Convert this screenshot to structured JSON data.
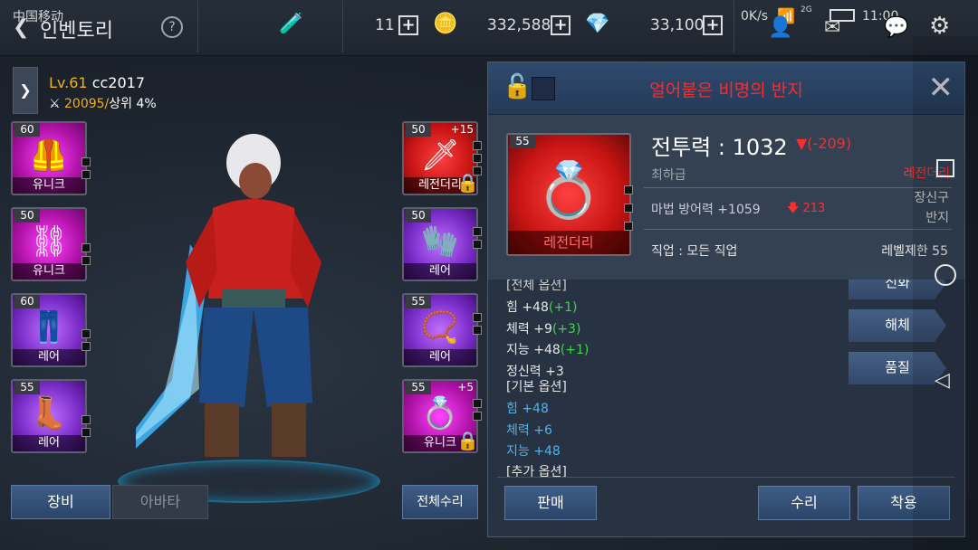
{
  "status_bar": {
    "carrier": "中国移动",
    "network_speed": "0K/s",
    "signal": "2G",
    "time": "11:00"
  },
  "header": {
    "title": "인벤토리",
    "help": "?"
  },
  "resources": [
    {
      "icon": "energy-icon",
      "value": ""
    },
    {
      "icon": "ticket-icon",
      "value": "11"
    },
    {
      "icon": "gold-coin-icon",
      "value": "332,588"
    },
    {
      "icon": "gem-icon",
      "value": "33,100"
    }
  ],
  "character": {
    "level": "Lv.61",
    "name": "cc2017",
    "power": "20095/",
    "rank": "상위 4%"
  },
  "left_slots": [
    {
      "level": "60",
      "rarity": "유니크",
      "rclass": "unique",
      "icon": "armor-top-icon",
      "glyph": "🦺"
    },
    {
      "level": "50",
      "rarity": "유니크",
      "rclass": "unique",
      "icon": "belt-icon",
      "glyph": "⛓"
    },
    {
      "level": "60",
      "rarity": "레어",
      "rclass": "rare",
      "icon": "pants-icon",
      "glyph": "👖"
    },
    {
      "level": "55",
      "rarity": "레어",
      "rclass": "rare",
      "icon": "boots-icon",
      "glyph": "👢"
    }
  ],
  "right_slots": [
    {
      "level": "50",
      "enhance": "+15",
      "rarity": "레전더리",
      "rclass": "legend",
      "icon": "sword-icon",
      "glyph": "🗡",
      "locked": true
    },
    {
      "level": "50",
      "enhance": "",
      "rarity": "레어",
      "rclass": "rare",
      "icon": "gauntlet-icon",
      "glyph": "🧤",
      "locked": false
    },
    {
      "level": "55",
      "enhance": "",
      "rarity": "레어",
      "rclass": "rare",
      "icon": "necklace-icon",
      "glyph": "📿",
      "locked": false
    },
    {
      "level": "55",
      "enhance": "+5",
      "rarity": "유니크",
      "rclass": "unique",
      "icon": "ring-icon",
      "glyph": "💍",
      "locked": true
    }
  ],
  "bottom_tabs": {
    "equip": "장비",
    "avatar": "아바타",
    "repair_all": "전체수리"
  },
  "item_detail": {
    "name": "얼어붙은 비명의 반지",
    "level": "55",
    "rarity": "레전더리",
    "combat_power_label": "전투력 : 1032",
    "combat_power_delta": "▼(-209)",
    "grade": "최하급",
    "grade_right": "레전더리",
    "slot_label": "장신구\n반지",
    "magic_def": "마법 방어력 +1059",
    "magic_def_delta": "213",
    "job": "직업 : 모든 직업",
    "req_level": "레벨제한 55",
    "stats_header_partial": "[전체 옵션]",
    "stats": [
      {
        "base": "힘 +48",
        "bonus": "(+1)"
      },
      {
        "base": "체력 +9",
        "bonus": "(+3)"
      },
      {
        "base": "지능 +48",
        "bonus": "(+1)"
      },
      {
        "base": "정신력 +3",
        "bonus": ""
      }
    ],
    "basic_header": "[기본 옵션]",
    "basic_stats": [
      "힘 +48",
      "체력 +6",
      "지능 +48"
    ],
    "extra_header": "[추가 옵션]",
    "side_buttons": [
      "신화",
      "해체",
      "품질"
    ],
    "footer": {
      "sell": "판매",
      "repair": "수리",
      "equip": "착용"
    }
  }
}
